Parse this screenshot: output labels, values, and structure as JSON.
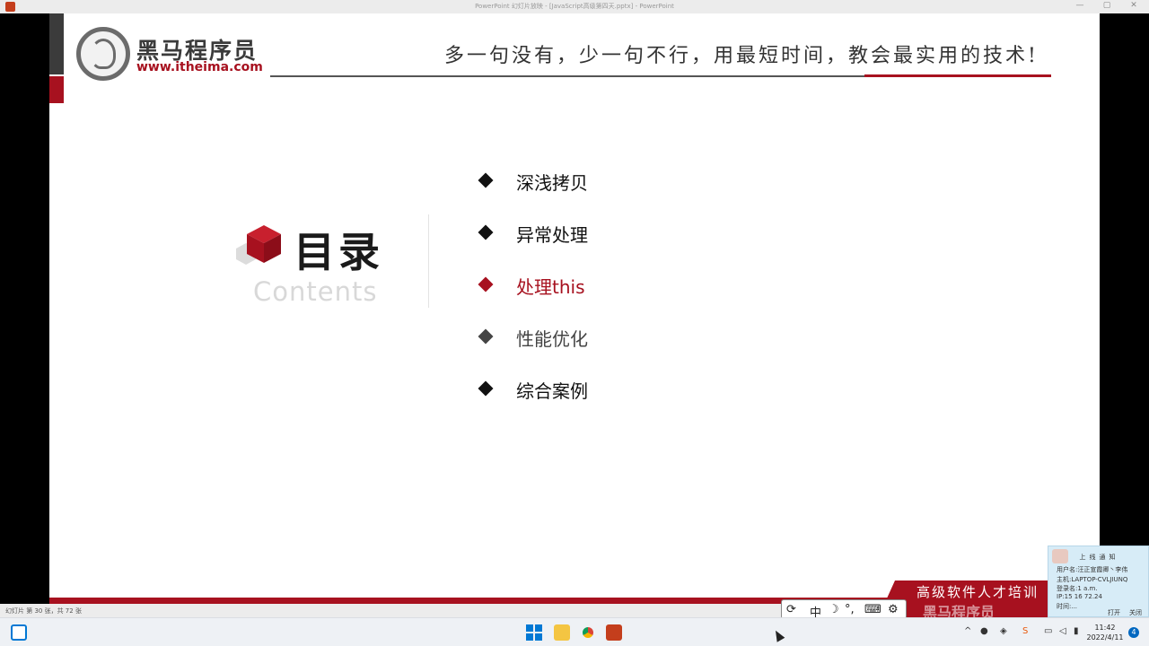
{
  "window": {
    "title": "PowerPoint 幻灯片放映 - [JavaScript高级第四天.pptx] - PowerPoint",
    "controls": [
      "—",
      "▢",
      "✕"
    ]
  },
  "slide": {
    "logo": {
      "name": "黑马程序员",
      "url": "www.itheima.com"
    },
    "slogan": "多一句没有，少一句不行，用最短时间，教会最实用的技术!",
    "heading": "目录",
    "subheading": "Contents",
    "menu": [
      {
        "label": "深浅拷贝",
        "color": "#111111"
      },
      {
        "label": "异常处理",
        "color": "#111111"
      },
      {
        "label": "处理this",
        "color": "#a7111f"
      },
      {
        "label": "性能优化",
        "color": "#444444"
      },
      {
        "label": "综合案例",
        "color": "#111111"
      }
    ],
    "colors": {
      "brand_red": "#a7111f",
      "brand_dark": "#3b3b3b"
    }
  },
  "statusbar": {
    "slide_count": "幻灯片 第 30 张，共 72 张"
  },
  "ime_toolbar": {
    "items": [
      "⟳",
      "中",
      "☽",
      "°,",
      "⌨",
      "⚙"
    ]
  },
  "banner": {
    "line1": "高级软件人才培训",
    "line2": "黑马程序员"
  },
  "notice": {
    "title": "上线通知",
    "lines": [
      "用户名:汪正宣霞卿丶李伟",
      "主机:LAPTOP-CVLJIUNQ",
      "登录名:1 a.m.",
      "IP:15 16 72.24",
      "时间:..."
    ],
    "buttons": [
      "打开",
      "关闭"
    ]
  },
  "taskbar": {
    "apps": [
      "windows-start",
      "file-explorer",
      "chrome",
      "powerpoint"
    ],
    "clock_time": "11:42",
    "clock_date": "2022/4/11",
    "notification_count": "4"
  }
}
